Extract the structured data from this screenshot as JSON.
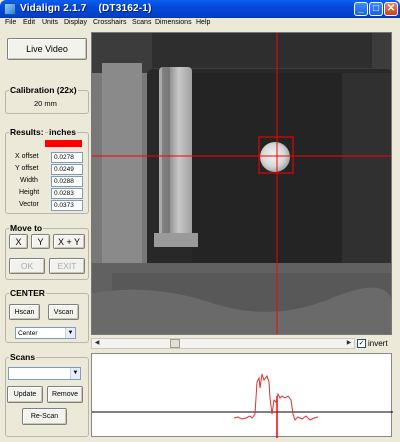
{
  "window": {
    "title": "Vidalign 2.1.7    (DT3162-1)",
    "controls": {
      "minimize": "_",
      "maximize": "□",
      "close": "✕"
    }
  },
  "menu": [
    "File",
    "Edit",
    "Units",
    "Display",
    "Crosshairs",
    "Scans",
    "Dimensions",
    "Help"
  ],
  "live_video_button": "Live Video",
  "calibration": {
    "title": "Calibration (22x)",
    "value": "20 mm"
  },
  "results": {
    "title": "Results:",
    "units": "inches",
    "status_color": "#ff0000",
    "rows": [
      {
        "label": "X offset",
        "value": "0.0278"
      },
      {
        "label": "Y offset",
        "value": "0.0249"
      },
      {
        "label": "Width",
        "value": "0.0288"
      },
      {
        "label": "Height",
        "value": "0.0283"
      },
      {
        "label": "Vector",
        "value": "0.0373"
      }
    ]
  },
  "move_to": {
    "title": "Move to",
    "buttons": [
      "X",
      "Y",
      "X + Y"
    ],
    "ok": "OK",
    "exit": "EXIT"
  },
  "center": {
    "title": "CENTER",
    "hscan": "Hscan",
    "vscan": "Vscan",
    "mode_selected": "Center"
  },
  "scans": {
    "title": "Scans",
    "selected": "",
    "update": "Update",
    "remove": "Remove",
    "rescan": "Re-Scan"
  },
  "viewer": {
    "invert_label": "invert",
    "invert_checked": true,
    "crosshair_color": "#ff0000"
  },
  "scan_profile": {
    "color": "#e03030",
    "baseline_color": "#000000"
  }
}
